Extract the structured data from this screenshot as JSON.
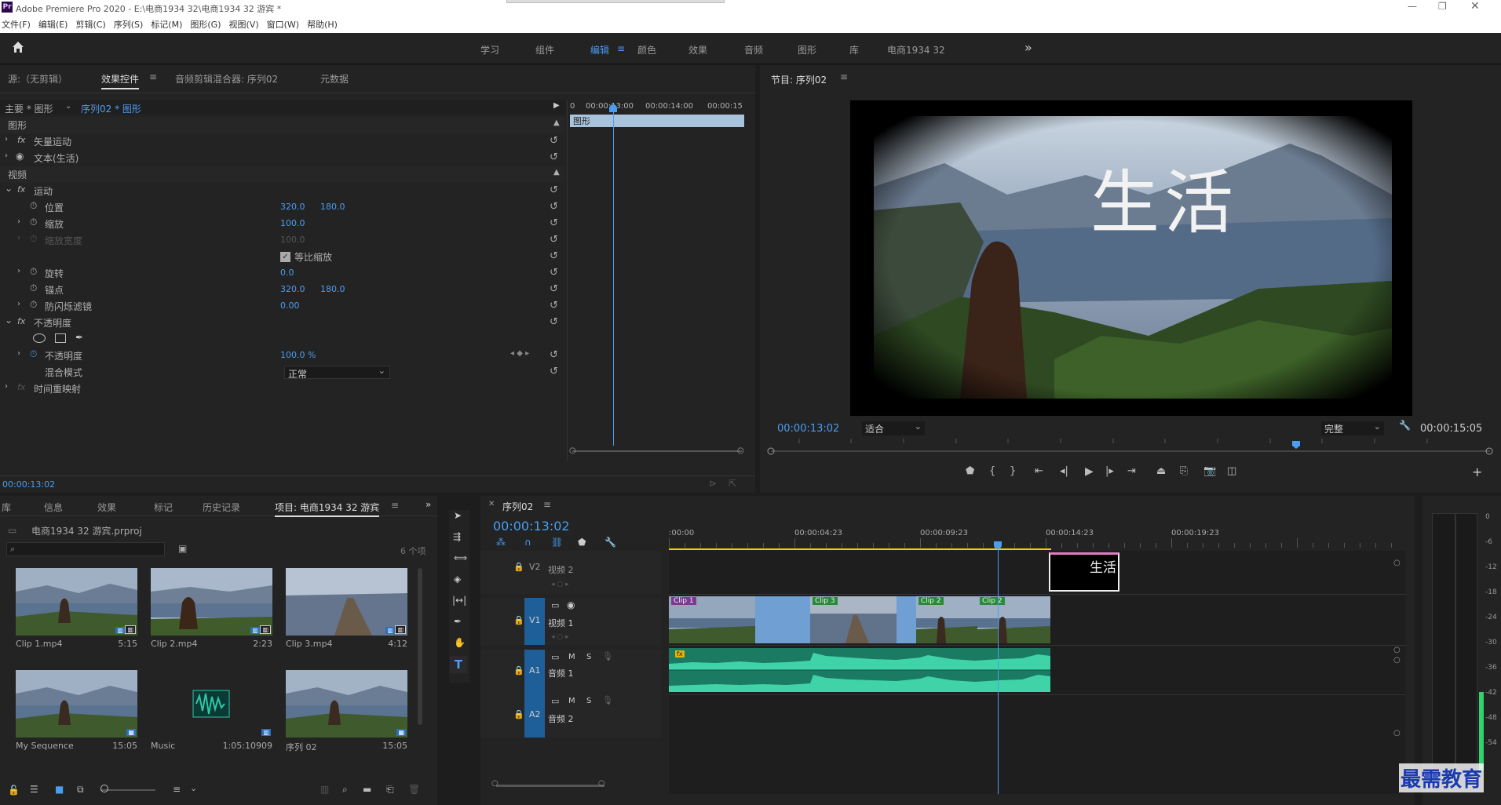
{
  "app": {
    "title": "Adobe Premiere Pro 2020 - E:\\电商1934 32\\电商1934 32 游宾 *",
    "logo": "Pr",
    "menu": [
      "文件(F)",
      "编辑(E)",
      "剪辑(C)",
      "序列(S)",
      "标记(M)",
      "图形(G)",
      "视图(V)",
      "窗口(W)",
      "帮助(H)"
    ]
  },
  "workspaces": {
    "items": [
      "学习",
      "组件",
      "编辑",
      "颜色",
      "效果",
      "音频",
      "图形",
      "库",
      "电商1934 32"
    ],
    "active": "编辑",
    "more": "»"
  },
  "source_panel": {
    "tabs": [
      "源:（无剪辑）",
      "效果控件",
      "音频剪辑混合器: 序列02",
      "元数据"
    ],
    "active_tab": "效果控件",
    "breadcrumb_main": "主要 * 图形",
    "breadcrumb_seq": "序列02 * 图形",
    "mini_timeline": {
      "t0": "0",
      "t1": "00:00:13:00",
      "t2": "00:00:14:00",
      "t3": "00:00:15",
      "clip": "图形"
    },
    "sections": {
      "graphic": "图形",
      "vector_motion": "矢量运动",
      "text": "文本(生活)",
      "video": "视频",
      "motion": "运动",
      "opacity": "不透明度",
      "time_remap": "时间重映射"
    },
    "props": {
      "position": {
        "label": "位置",
        "x": "320.0",
        "y": "180.0"
      },
      "scale": {
        "label": "缩放",
        "v": "100.0"
      },
      "scale_width": {
        "label": "缩放宽度",
        "v": "100.0"
      },
      "uniform": {
        "label": "等比缩放"
      },
      "rotation": {
        "label": "旋转",
        "v": "0.0"
      },
      "anchor": {
        "label": "锚点",
        "x": "320.0",
        "y": "180.0"
      },
      "antiflicker": {
        "label": "防闪烁滤镜",
        "v": "0.00"
      },
      "opacity": {
        "label": "不透明度",
        "v": "100.0 %"
      },
      "blend": {
        "label": "混合模式",
        "v": "正常"
      }
    },
    "timecode": "00:00:13:02"
  },
  "program_monitor": {
    "title": "节目: 序列02",
    "overlay_text": "生活",
    "current_time": "00:00:13:02",
    "fit": "适合",
    "quality": "完整",
    "duration": "00:00:15:05"
  },
  "project_panel": {
    "tabs": [
      "库",
      "信息",
      "效果",
      "标记",
      "历史记录",
      "项目: 电商1934 32 游宾"
    ],
    "active_tab": "项目: 电商1934 32 游宾",
    "project_file": "电商1934 32 游宾.prproj",
    "search_placeholder": "",
    "count": "6 个项",
    "items": [
      {
        "name": "Clip 1.mp4",
        "duration": "5:15"
      },
      {
        "name": "Clip 2.mp4",
        "duration": "2:23"
      },
      {
        "name": "Clip 3.mp4",
        "duration": "4:12"
      },
      {
        "name": "My Sequence",
        "duration": "15:05"
      },
      {
        "name": "Music",
        "duration": "1:05:10909"
      },
      {
        "name": "序列 02",
        "duration": "15:05"
      }
    ]
  },
  "timeline": {
    "tab": "序列02",
    "timecode": "00:00:13:02",
    "ruler": [
      ":00:00",
      "00:00:04:23",
      "00:00:09:23",
      "00:00:14:23",
      "00:00:19:23"
    ],
    "tracks": {
      "v2": {
        "id": "V2",
        "name": "视频 2"
      },
      "v1": {
        "id": "V1",
        "name": "视频 1"
      },
      "a1": {
        "id": "A1",
        "name": "音频 1"
      },
      "a2": {
        "id": "A2",
        "name": "音频 2"
      }
    },
    "clips": [
      "Clip 1",
      "Clip 3",
      "Clip 2",
      "Clip 2"
    ],
    "title_clip": "生活",
    "m": "M",
    "s": "S"
  },
  "meter": {
    "ticks": [
      "0",
      "-6",
      "-12",
      "-18",
      "-24",
      "-30",
      "-36",
      "-42",
      "-48",
      "-54"
    ]
  },
  "watermark": "最需教育"
}
